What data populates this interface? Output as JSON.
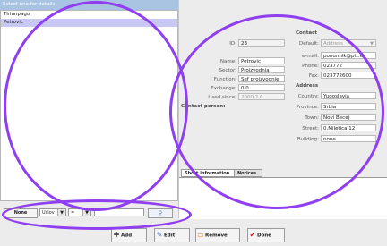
{
  "left_panel": {
    "header": "Select one for details",
    "items": [
      {
        "label": "Tiriunpago",
        "selected": false
      },
      {
        "label": "Petrovic",
        "selected": true
      }
    ],
    "filter": {
      "none_label": "None",
      "field_value": "Uslov",
      "operator_value": "=",
      "text_value": ""
    }
  },
  "details": {
    "id_label": "ID:",
    "id_value": "23",
    "name_label": "Name:",
    "name_value": "Petrovic",
    "sector_label": "Sector:",
    "sector_value": "Proizvodnja",
    "function_label": "Function:",
    "function_value": "Sef proizvodnje",
    "exchange_label": "Exchange:",
    "exchange_value": "0.0",
    "used_since_label": "Used since:",
    "used_since_value": "2000.2.6",
    "contact_person_label": "Contact person:"
  },
  "contact": {
    "section_label": "Contact",
    "default_label": "Default:",
    "default_value": "Address",
    "email_label": "e-mail:",
    "email_value": "ponunnik@ptt.eu",
    "phone_label": "Phone:",
    "phone_value": "023772",
    "fax_label": "Fax:",
    "fax_value": "023772600"
  },
  "address": {
    "section_label": "Address",
    "country_label": "Country:",
    "country_value": "Yugoslavia",
    "province_label": "Province:",
    "province_value": "Srbia",
    "town_label": "Town:",
    "town_value": "Novi Becej",
    "street_label": "Street:",
    "street_value": "0.Miletica 12",
    "building_label": "Building:",
    "building_value": "none"
  },
  "tabs": [
    {
      "label": "Short information",
      "active": true
    },
    {
      "label": "Notices",
      "active": false
    }
  ],
  "actions": {
    "add_label": "Add",
    "edit_label": "Edit",
    "remove_label": "Remove",
    "done_label": "Done"
  },
  "colors": {
    "list_header": "#a9c4e3",
    "selection": "#c8c8f2",
    "annotation": "#8f3ef0"
  }
}
